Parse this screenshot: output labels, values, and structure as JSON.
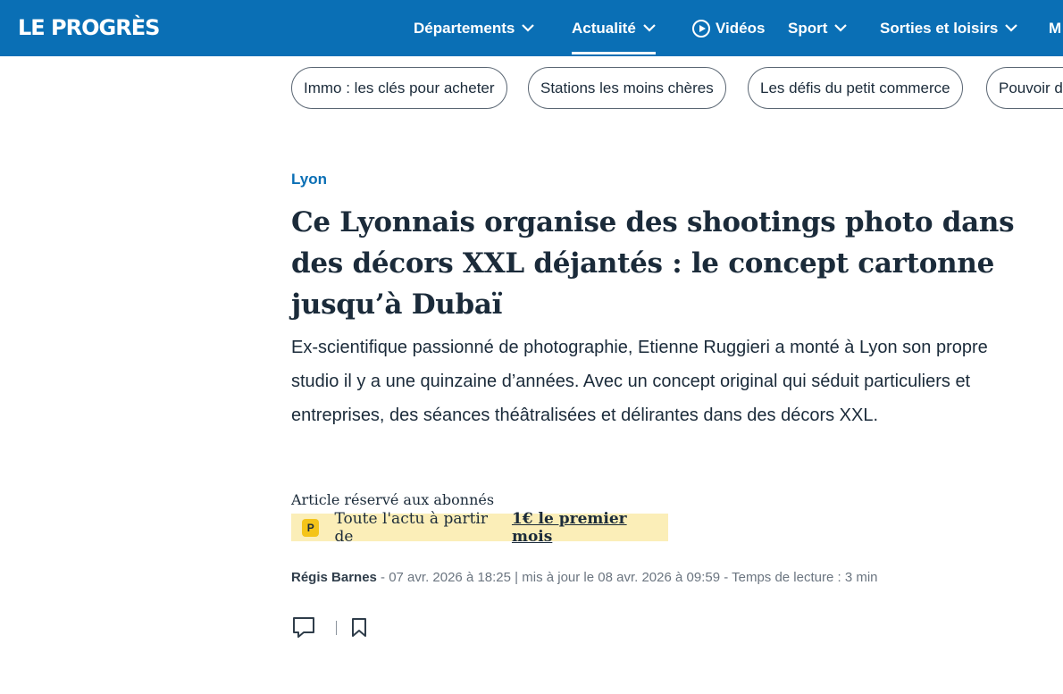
{
  "header": {
    "logo": "LE PROGRÈS",
    "nav": [
      {
        "label": "Départements"
      },
      {
        "label": "Actualité"
      },
      {
        "label": "Vidéos"
      },
      {
        "label": "Sport"
      },
      {
        "label": "Sorties et loisirs"
      },
      {
        "label": "M"
      }
    ],
    "active_nav": "Actualité",
    "colors": {
      "brand": "#0a6fb5",
      "text_dark": "#1b2b3a"
    }
  },
  "chips": [
    {
      "label": "Immo : les clés pour acheter"
    },
    {
      "label": "Stations les moins chères"
    },
    {
      "label": "Les défis du petit commerce"
    },
    {
      "label": "Pouvoir d"
    }
  ],
  "article": {
    "kicker": "Lyon",
    "title": "Ce Lyonnais organise des shootings photo dans des décors XXL déjantés : le concept cartonne jusqu’à Dubaï",
    "lead": "Ex-scientifique passionné de photographie, Etienne Ruggieri a monté à Lyon son propre studio il y a une quinzaine d’années. Avec un concept original qui séduit particuliers et entreprises, des séances théâtralisées et délirantes dans des décors XXL.",
    "subscriber_note": "Article réservé aux abonnés",
    "offer": {
      "badge": "P",
      "text": "Toute l'actu à partir de",
      "link": "1€ le premier mois"
    },
    "meta": {
      "author": "Régis Barnes",
      "published": "- 07 avr. 2026 à 18:25",
      "updated": "| mis à jour le 08 avr. 2026 à 09:59",
      "reading_time": "- Temps de lecture : 3 min"
    },
    "actions": {
      "comment_icon": "comment-icon",
      "bookmark_icon": "bookmark-icon"
    }
  }
}
